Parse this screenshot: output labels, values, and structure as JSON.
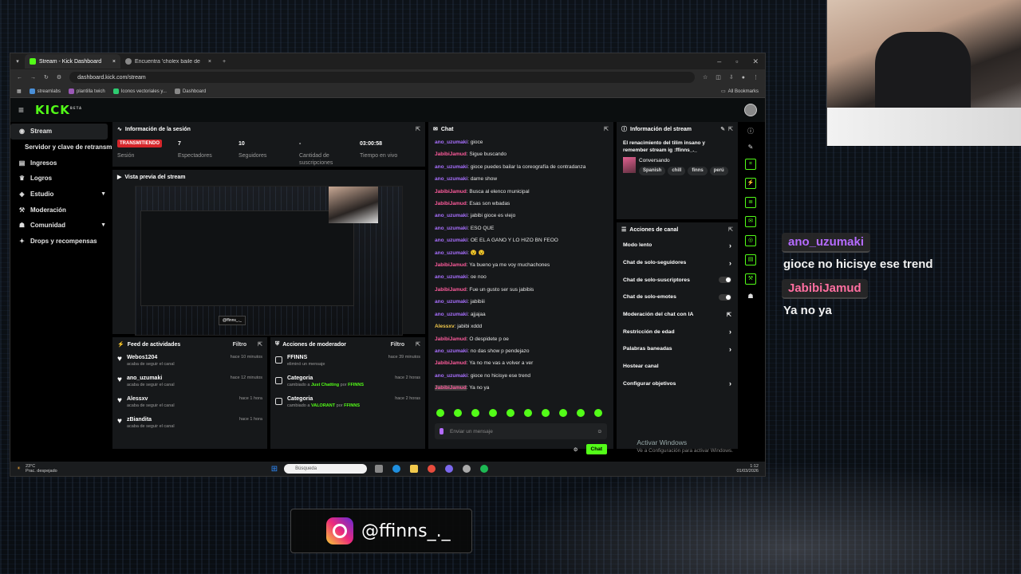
{
  "overlay": {
    "chat": [
      {
        "user": "ano_uzumaki",
        "color": "#b56bff",
        "message": "gioce no hicisye ese trend"
      },
      {
        "user": "JabibiJamud",
        "color": "#ff6fa0",
        "message": "Ya no ya"
      }
    ],
    "instagram_handle": "@ffinns_._"
  },
  "browser": {
    "tabs": [
      {
        "label": "Stream - Kick Dashboard"
      },
      {
        "label": "Encuentra 'cholex baile de cont..."
      }
    ],
    "url": "dashboard.kick.com/stream",
    "bookmarks": [
      "streamlabs",
      "plantilla twich",
      "Iconos vectoriales y...",
      "Dashboard"
    ],
    "all_bookmarks": "All Bookmarks"
  },
  "kick": {
    "logo": "KICK",
    "logo_badge": "BETA",
    "sidebar": [
      {
        "label": "Stream",
        "icon": "stream-icon",
        "active": true
      },
      {
        "label": "Servidor y clave de retransmisión",
        "sub": true
      },
      {
        "label": "Ingresos",
        "icon": "money-icon"
      },
      {
        "label": "Logros",
        "icon": "trophy-icon"
      },
      {
        "label": "Estudio",
        "icon": "studio-icon",
        "chevron": true
      },
      {
        "label": "Moderación",
        "icon": "gavel-icon"
      },
      {
        "label": "Comunidad",
        "icon": "community-icon",
        "chevron": true
      },
      {
        "label": "Drops y recompensas",
        "icon": "drops-icon"
      }
    ],
    "session": {
      "title": "Información de la sesión",
      "badge": "TRANSMITIENDO",
      "cells": [
        {
          "value": "",
          "label": "Sesión"
        },
        {
          "value": "7",
          "label": "Espectadores"
        },
        {
          "value": "10",
          "label": "Seguidores"
        },
        {
          "value": "-",
          "label": "Cantidad de suscripciones"
        },
        {
          "value": "03:00:58",
          "label": "Tiempo en vivo"
        }
      ]
    },
    "preview": {
      "title": "Vista previa del stream",
      "tag": "@ffinns_._"
    },
    "feed": {
      "title": "Feed de actividades",
      "filter": "Filtro",
      "items": [
        {
          "name": "Webos1204",
          "sub": "acaba de seguir el canal",
          "time": "hace 10 minutos"
        },
        {
          "name": "ano_uzumaki",
          "sub": "acaba de seguir el canal",
          "time": "hace 12 minutos"
        },
        {
          "name": "Alessxv",
          "sub": "acaba de seguir el canal",
          "time": "hace 1 hora"
        },
        {
          "name": "zBiandita",
          "sub": "acaba de seguir el canal",
          "time": "hace 1 hora"
        }
      ]
    },
    "mod_actions": {
      "title": "Acciones de moderador",
      "filter": "Filtro",
      "items": [
        {
          "name": "FFINNS",
          "sub_prefix": "eliminó un mensaje",
          "highlight": "",
          "sub_mid": "",
          "sub_tail": "",
          "time": "hace 39 minutos"
        },
        {
          "name": "Categoria",
          "sub_prefix": "cambiado a ",
          "highlight": "Just Chatting",
          "sub_mid": " por ",
          "sub_tail": "FFINNS",
          "time": "hace 2 horas"
        },
        {
          "name": "Categoria",
          "sub_prefix": "cambiado a ",
          "highlight": "VALORANT",
          "sub_mid": " por ",
          "sub_tail": "FFINNS",
          "time": "hace 2 horas"
        }
      ]
    },
    "chat": {
      "title": "Chat",
      "messages": [
        {
          "user": "ano_uzumaki",
          "text": "gioce",
          "c": 1
        },
        {
          "user": "JabibiJamud",
          "text": "Sigue buscando",
          "c": 2
        },
        {
          "user": "ano_uzumaki",
          "text": "gioce puedes bailar la coreografía de contradanza",
          "c": 1
        },
        {
          "user": "ano_uzumaki",
          "text": "dame show",
          "c": 1
        },
        {
          "user": "JabibiJamud",
          "text": "Busca al elenco municipal",
          "c": 2
        },
        {
          "user": "JabibiJamud",
          "text": "Esas son wbadas",
          "c": 2
        },
        {
          "user": "ano_uzumaki",
          "text": "jabibi gioce es viejo",
          "c": 1
        },
        {
          "user": "ano_uzumaki",
          "text": "ESO QUE",
          "c": 1
        },
        {
          "user": "ano_uzumaki",
          "text": "OE EL A GANO Y LO HIZO BN FEOO",
          "c": 1
        },
        {
          "user": "ano_uzumaki",
          "text": "😵 😵",
          "c": 1
        },
        {
          "user": "JabibiJamud",
          "text": "Ya bueno ya me voy muchachones",
          "c": 2
        },
        {
          "user": "ano_uzumaki",
          "text": "oe noo",
          "c": 1
        },
        {
          "user": "JabibiJamud",
          "text": "Fue un gusto ser sus jabibis",
          "c": 2
        },
        {
          "user": "ano_uzumaki",
          "text": "jabibiii",
          "c": 1
        },
        {
          "user": "ano_uzumaki",
          "text": "ajjajaa",
          "c": 1
        },
        {
          "user": "Alessxv",
          "text": "jabibi xddd",
          "c": 3
        },
        {
          "user": "JabibiJamud",
          "text": "O despidete p oe",
          "c": 2
        },
        {
          "user": "ano_uzumaki",
          "text": "no das show p pendejazo",
          "c": 1
        },
        {
          "user": "JabibiJamud",
          "text": "Ya no me vas a volver a ver",
          "c": 2
        },
        {
          "user": "ano_uzumaki",
          "text": "gioce no hicisye ese trend",
          "c": 1
        },
        {
          "user": "JabibiJamud",
          "text": "Ya no ya",
          "c": 2,
          "hl": true
        }
      ],
      "input_placeholder": "Enviar un mensaje",
      "send_label": "Chat"
    },
    "stream_info": {
      "title": "Información del stream",
      "stream_title": "El renacimiento del tilim insano y remember stream ig :ffinns_._",
      "category": "Conversando",
      "tags": [
        "Spanish",
        "chill",
        "finns",
        "perú"
      ]
    },
    "channel_actions": {
      "title": "Acciones de canal",
      "items": [
        {
          "label": "Modo lento",
          "ctrl": "arrow"
        },
        {
          "label": "Chat de solo-seguidores",
          "ctrl": "arrow"
        },
        {
          "label": "Chat de solo-suscriptores",
          "ctrl": "toggle"
        },
        {
          "label": "Chat de solo-emotes",
          "ctrl": "toggle"
        },
        {
          "label": "Moderación del chat con IA",
          "ctrl": "ext"
        },
        {
          "label": "Restricción de edad",
          "ctrl": "arrow"
        },
        {
          "label": "Palabras baneadas",
          "ctrl": "arrow"
        },
        {
          "label": "Hostear canal",
          "ctrl": "none"
        },
        {
          "label": "Configurar objetivos",
          "ctrl": "arrow"
        }
      ]
    },
    "activate_windows": {
      "title": "Activar Windows",
      "sub": "Ve a Configuración para activar Windows."
    }
  },
  "taskbar": {
    "temp": "23°C",
    "weather": "Prac. despejado",
    "search_placeholder": "Búsqueda",
    "time": "1:12",
    "date": "01/03/2026"
  }
}
